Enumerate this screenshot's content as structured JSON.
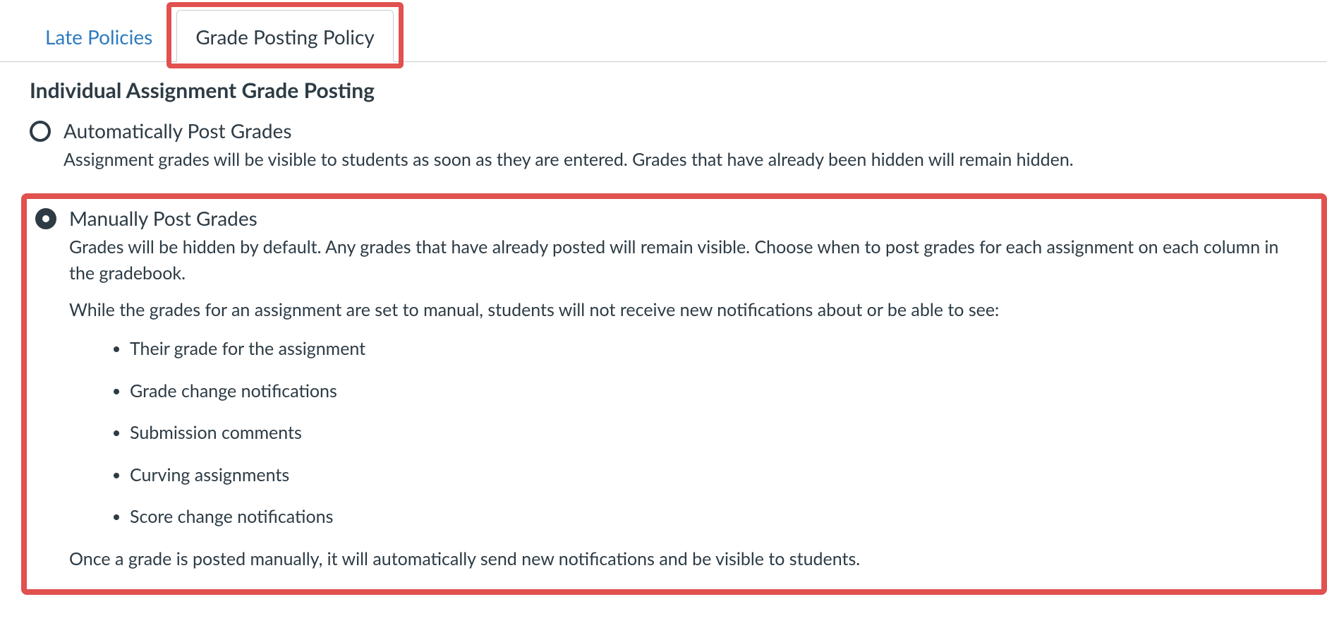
{
  "tabs": {
    "late_policies": "Late Policies",
    "grade_posting": "Grade Posting Policy"
  },
  "section_title": "Individual Assignment Grade Posting",
  "options": {
    "auto": {
      "title": "Automatically Post Grades",
      "desc": "Assignment grades will be visible to students as soon as they are entered. Grades that have already been hidden will remain hidden."
    },
    "manual": {
      "title": "Manually Post Grades",
      "desc1": "Grades will be hidden by default. Any grades that have already posted will remain visible. Choose when to post grades for each assignment on each column in the gradebook.",
      "desc2": "While the grades for an assignment are set to manual, students will not receive new notifications about or be able to see:",
      "list": [
        "Their grade for the assignment",
        "Grade change notifications",
        "Submission comments",
        "Curving assignments",
        "Score change notifications"
      ],
      "desc3": "Once a grade is posted manually, it will automatically send new notifications and be visible to students."
    }
  }
}
